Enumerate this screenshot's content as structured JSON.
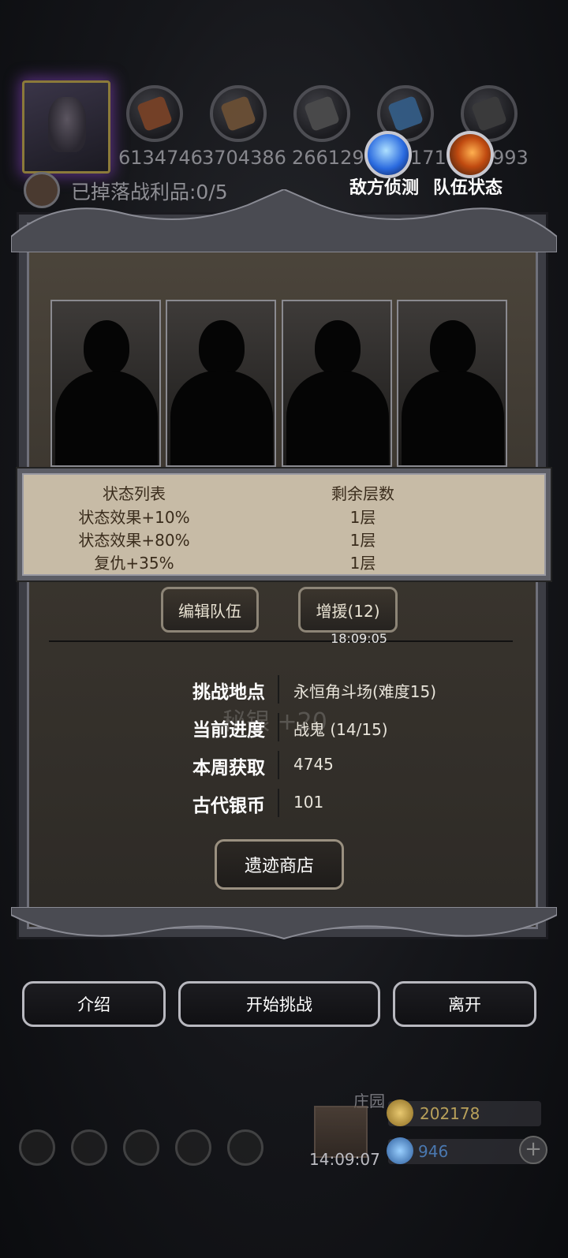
{
  "resources": [
    {
      "icon": "meat-icon",
      "value": "6134746"
    },
    {
      "icon": "wood-icon",
      "value": "3704386"
    },
    {
      "icon": "iron-icon",
      "value": "266129"
    },
    {
      "icon": "crystal-icon",
      "value": "171"
    },
    {
      "icon": "ore-icon",
      "value": "993"
    }
  ],
  "spoils_text": "已掉落战利品:0/5",
  "skills": {
    "enemy_scout": "敌方侦测",
    "team_status": "队伍状态"
  },
  "status_table": {
    "header_name": "状态列表",
    "header_layers": "剩余层数",
    "rows": [
      {
        "name": "状态效果+10%",
        "layers": "1层"
      },
      {
        "name": "状态效果+80%",
        "layers": "1层"
      },
      {
        "name": "复仇+35%",
        "layers": "1层"
      }
    ]
  },
  "buttons": {
    "edit_team": "编辑队伍",
    "reinforce": "增援(12)",
    "relic_shop": "遗迹商店",
    "intro": "介绍",
    "start": "开始挑战",
    "leave": "离开"
  },
  "timer": "18:09:05",
  "info": [
    {
      "key": "挑战地点",
      "value": "永恒角斗场(难度15)"
    },
    {
      "key": "当前进度",
      "value": "战鬼 (14/15)"
    },
    {
      "key": "本周获取",
      "value": "4745"
    },
    {
      "key": "古代银币",
      "value": "101"
    }
  ],
  "ghost_text": "秘银 +20",
  "hud": {
    "village": "庄园",
    "clock": "14:09:07",
    "gold": "202178",
    "gems": "946"
  },
  "colors": {
    "status_bg": "#c7bba6",
    "gold": "#b8a05a",
    "gem": "#4a78b0"
  }
}
